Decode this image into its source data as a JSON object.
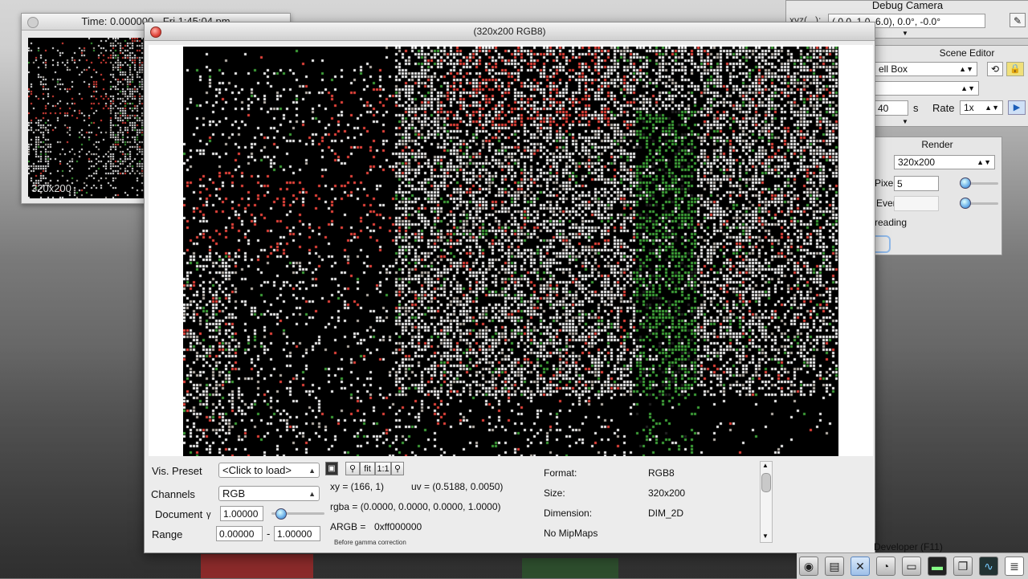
{
  "mini_window": {
    "title": "Time: 0.000000 - Fri 1:45:04 pm",
    "overlay": "320x200"
  },
  "debug_camera": {
    "title": "Debug Camera",
    "label": "xyz(...):",
    "value": "( 0.0, 1.0, 6.0), 0.0°, -0.0°"
  },
  "scene_editor": {
    "title": "Scene Editor",
    "scene_select": "ell Box",
    "second_select": "",
    "time_value": "40",
    "time_unit": "s",
    "rate_label": "Rate",
    "rate_value": "1x"
  },
  "render_panel": {
    "title": "Render",
    "resolution": "320x200",
    "pixel_label": "Pixel",
    "pixel_value": "5",
    "events_label": "Events",
    "events_value": "",
    "threading_label": "reading"
  },
  "viewer": {
    "title": "(320x200 RGB8)",
    "vis_preset_label": "Vis. Preset",
    "vis_preset_value": "<Click to load>",
    "channels_label": "Channels",
    "channels_value": "RGB",
    "document_label": "Document",
    "gamma_symbol": "γ",
    "gamma_value": "1.00000",
    "range_label": "Range",
    "range_min": "0.00000",
    "range_sep": "-",
    "range_max": "1.00000",
    "fit_label": "fit",
    "one_to_one_label": "1:1",
    "xy": "xy = (166, 1)",
    "uv": "uv = (0.5188, 0.0050)",
    "rgba": "rgba = (0.0000, 0.0000, 0.0000, 1.0000)",
    "argb_label": "ARGB =",
    "argb_value": "0xff000000",
    "gamma_note": "Before gamma correction",
    "format_label": "Format:",
    "format_value": "RGB8",
    "size_label": "Size:",
    "size_value": "320x200",
    "dimension_label": "Dimension:",
    "dimension_value": "DIM_2D",
    "mipmaps": "No MipMaps"
  },
  "developer": {
    "title": "Developer (F11)",
    "icons": [
      "camera-icon",
      "film-icon",
      "tools-icon",
      "speedometer-icon",
      "note-icon",
      "terminal-icon",
      "windows-icon",
      "graph-icon",
      "document-icon"
    ]
  },
  "colors": {
    "noise_red": "#e8453c",
    "noise_green": "#3fa33a",
    "noise_white": "#f2f2f2"
  }
}
